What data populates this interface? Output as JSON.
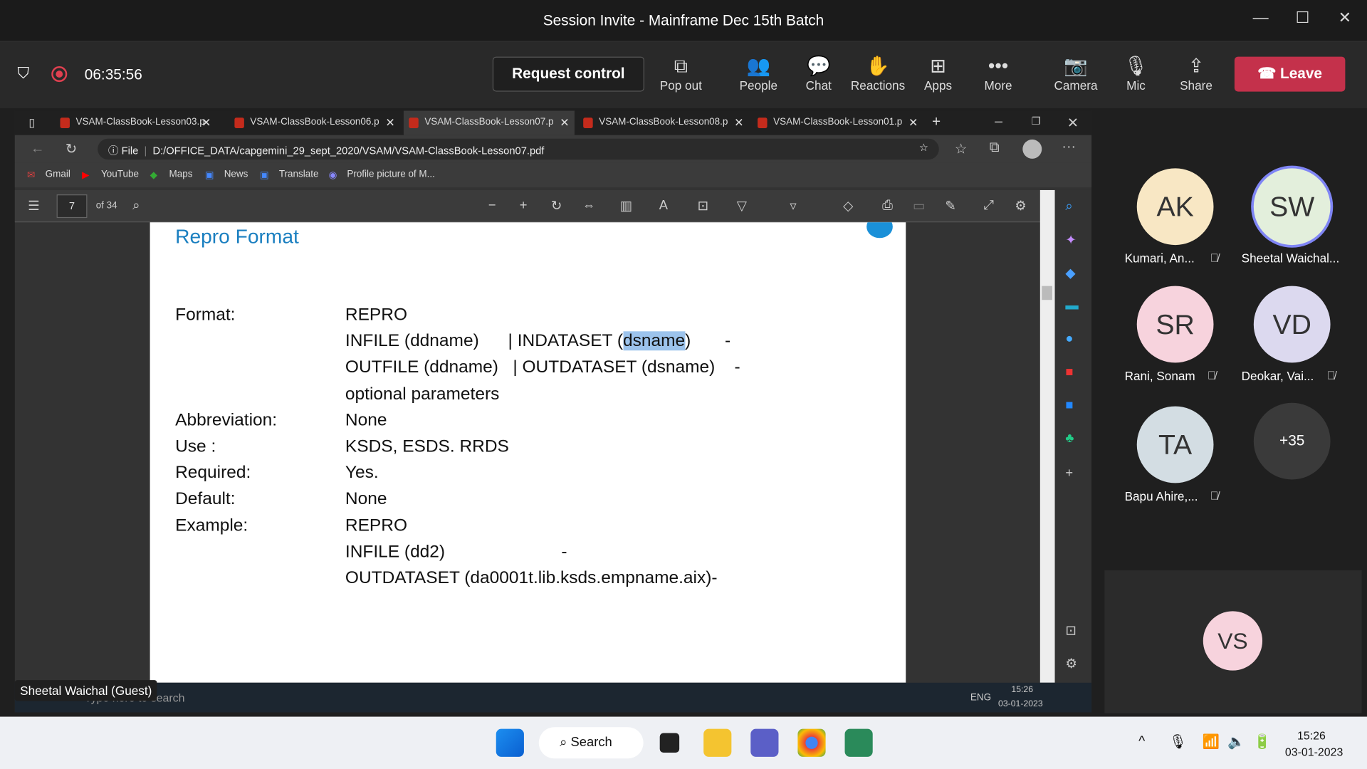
{
  "window": {
    "title": "Session Invite - Mainframe Dec 15th Batch",
    "minimize": "—",
    "maximize": "☐",
    "close": "✕"
  },
  "meeting": {
    "timer": "06:35:56",
    "request_control": "Request control",
    "tools": [
      "Pop out",
      "People",
      "Chat",
      "Reactions",
      "Apps",
      "More",
      "Camera",
      "Mic",
      "Share"
    ],
    "leave": "Leave",
    "presenter": "Sheetal Waichal (Guest)"
  },
  "browser": {
    "tabs": [
      "VSAM-ClassBook-Lesson03.p",
      "VSAM-ClassBook-Lesson06.p",
      "VSAM-ClassBook-Lesson07.p",
      "VSAM-ClassBook-Lesson08.p",
      "VSAM-ClassBook-Lesson01.p"
    ],
    "url_prefix": "File",
    "url": "D:/OFFICE_DATA/capgemini_29_sept_2020/VSAM/VSAM-ClassBook-Lesson07.pdf",
    "bookmarks": [
      "Gmail",
      "YouTube",
      "Maps",
      "News",
      "Translate",
      "Profile picture of M..."
    ]
  },
  "pdf": {
    "page": "7",
    "of": "of 34",
    "title": "Repro Format",
    "lines": [
      {
        "label": "Format:",
        "value": "REPRO"
      },
      {
        "label": "",
        "value": "INFILE (ddname)      | INDATASET (",
        "hl": "dsname",
        ")tail": ""
      },
      {
        "label": "",
        "value": "OUTFILE (ddname)   | OUTDATASET (dsname)    -"
      },
      {
        "label": "",
        "value": "optional parameters"
      },
      {
        "label": "Abbreviation:",
        "value": "None"
      },
      {
        "label": "Use     :",
        "value": "KSDS, ESDS. RRDS"
      },
      {
        "label": "Required:",
        "value": "Yes."
      },
      {
        "label": "Default:",
        "value": "None"
      },
      {
        "label": "Example:",
        "value": "REPRO"
      },
      {
        "label": "",
        "value": "INFILE (dd2)                        -"
      },
      {
        "label": "",
        "value": "OUTDATASET (da0001t.lib.ksds.empname.aix)-"
      }
    ],
    "line2_tail": ")       -"
  },
  "remote_taskbar": {
    "search": "Type here to search",
    "lang": "ENG",
    "time": "15:26",
    "date": "03-01-2023"
  },
  "participants": [
    {
      "initials": "AK",
      "name": "Kumari, An...",
      "color": "#f8e7c4"
    },
    {
      "initials": "SW",
      "name": "Sheetal Waichal...",
      "color": "#e3efdc"
    },
    {
      "initials": "SR",
      "name": "Rani, Sonam",
      "color": "#f7d3dd"
    },
    {
      "initials": "VD",
      "name": "Deokar, Vai...",
      "color": "#dcd9ef"
    },
    {
      "initials": "TA",
      "name": "Bapu Ahire,...",
      "color": "#d3dde3"
    }
  ],
  "more_participants": "+35",
  "self": {
    "initials": "VS"
  },
  "taskbar": {
    "search": "Search",
    "time": "15:26",
    "date": "03-01-2023"
  }
}
